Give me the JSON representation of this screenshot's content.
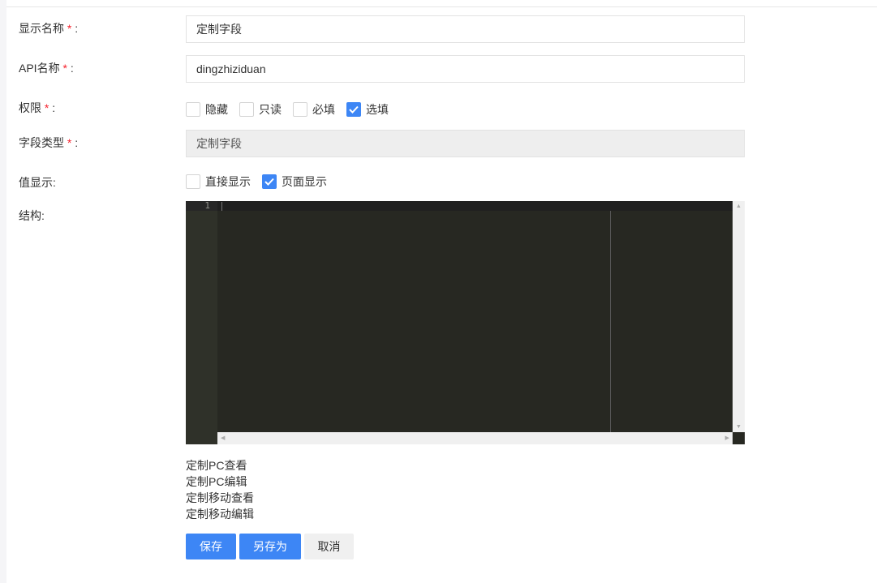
{
  "form": {
    "display_name": {
      "label": "显示名称",
      "required": "*",
      "colon": ":",
      "value": "定制字段"
    },
    "api_name": {
      "label": "API名称",
      "required": "*",
      "colon": ":",
      "value": "dingzhiziduan"
    },
    "permission": {
      "label": "权限",
      "required": "*",
      "colon": ":",
      "options": [
        {
          "label": "隐藏",
          "checked": false
        },
        {
          "label": "只读",
          "checked": false
        },
        {
          "label": "必填",
          "checked": false
        },
        {
          "label": "选填",
          "checked": true
        }
      ]
    },
    "field_type": {
      "label": "字段类型",
      "required": "*",
      "colon": ":",
      "value": "定制字段"
    },
    "value_display": {
      "label": "值显示:",
      "options": [
        {
          "label": "直接显示",
          "checked": false
        },
        {
          "label": "页面显示",
          "checked": true
        }
      ]
    },
    "structure": {
      "label": "结构:",
      "line_number": "1"
    }
  },
  "links": [
    "定制PC查看",
    "定制PC编辑",
    "定制移动查看",
    "定制移动编辑"
  ],
  "buttons": {
    "save": "保存",
    "save_as": "另存为",
    "cancel": "取消"
  },
  "colors": {
    "primary": "#3d86f5",
    "required": "#f5222d",
    "editor_bg": "#272822"
  }
}
